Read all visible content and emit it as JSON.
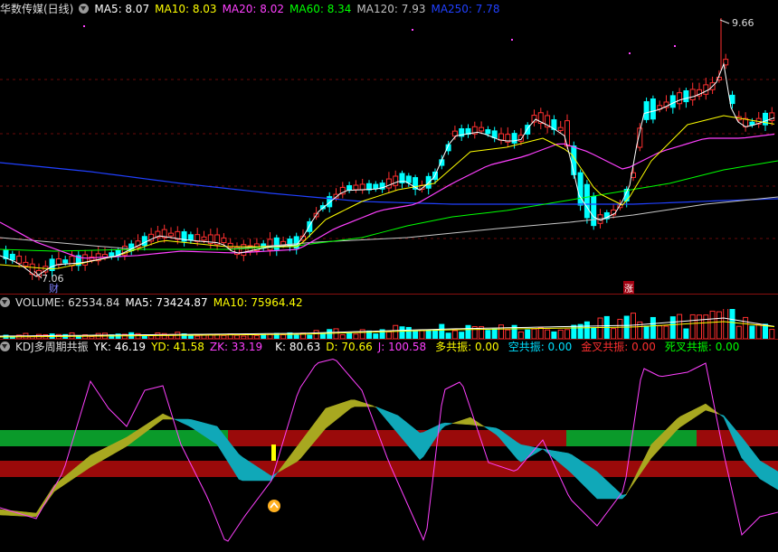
{
  "price_panel": {
    "title": "华数传媒(日线)",
    "ma": [
      {
        "label": "MA5: 8.07",
        "color": "#ffffff"
      },
      {
        "label": "MA10: 8.03",
        "color": "#ffff00"
      },
      {
        "label": "MA20: 8.02",
        "color": "#ff40ff"
      },
      {
        "label": "MA60: 8.34",
        "color": "#00ff00"
      },
      {
        "label": "MA120: 7.93",
        "color": "#c0c0c0"
      },
      {
        "label": "MA250: 7.78",
        "color": "#2040ff"
      }
    ],
    "high_label": "9.66",
    "low_label": "7.06",
    "cai_marker": "财",
    "zhang_marker": "涨"
  },
  "volume_panel": {
    "labels": [
      {
        "label": "VOLUME: 62534.84",
        "color": "#dddddd"
      },
      {
        "label": "MA5: 73424.87",
        "color": "#ffffff"
      },
      {
        "label": "MA10: 75964.42",
        "color": "#ffff00"
      }
    ]
  },
  "kdj_panel": {
    "labels": [
      {
        "label": "KDJ多周期共振",
        "color": "#dddddd"
      },
      {
        "label": "YK: 46.19",
        "color": "#ffffff"
      },
      {
        "label": "YD: 41.58",
        "color": "#ffff00"
      },
      {
        "label": "ZK: 33.19",
        "color": "#ff40ff"
      },
      {
        "label": "K: 80.63",
        "color": "#ffffff"
      },
      {
        "label": "D: 70.66",
        "color": "#ffff00"
      },
      {
        "label": "J: 100.58",
        "color": "#ff40ff"
      },
      {
        "label": "多共振: 0.00",
        "color": "#ffff00"
      },
      {
        "label": "空共振: 0.00",
        "color": "#00e0ff"
      },
      {
        "label": "金叉共振: 0.00",
        "color": "#ff3030"
      },
      {
        "label": "死叉共振: 0.00",
        "color": "#00ff00"
      }
    ]
  }
}
